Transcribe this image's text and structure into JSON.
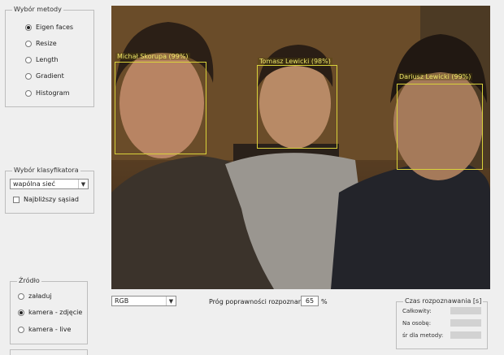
{
  "method_group": {
    "title": "Wybór metody",
    "options": [
      {
        "label": "Eigen faces",
        "selected": true
      },
      {
        "label": "Resize",
        "selected": false
      },
      {
        "label": "Length",
        "selected": false
      },
      {
        "label": "Gradient",
        "selected": false
      },
      {
        "label": "Histogram",
        "selected": false
      }
    ]
  },
  "classifier_group": {
    "title": "Wybór klasyfikatora",
    "select_value": "wapólna sieć",
    "checkbox_label": "Najbliższy sąsiad",
    "checkbox_checked": false
  },
  "source_group": {
    "title": "Źródło",
    "options": [
      {
        "label": "załaduj",
        "selected": false
      },
      {
        "label": "kamera - zdjęcie",
        "selected": true
      },
      {
        "label": "kamera - live",
        "selected": false
      }
    ]
  },
  "faces": [
    {
      "label": "Michał Skorupa (99%)"
    },
    {
      "label": "Tomasz Lewicki (98%)"
    },
    {
      "label": "Dariusz Lewicki (99%)"
    }
  ],
  "color_select": {
    "value": "RGB"
  },
  "threshold": {
    "label": "Próg poprawności rozpoznania",
    "value": "65",
    "unit": "%"
  },
  "timing_group": {
    "title": "Czas rozpoznawania [s]",
    "rows": [
      {
        "label": "Całkowity:"
      },
      {
        "label": "Na osobę:"
      },
      {
        "label": "śr dla metody:"
      }
    ]
  }
}
